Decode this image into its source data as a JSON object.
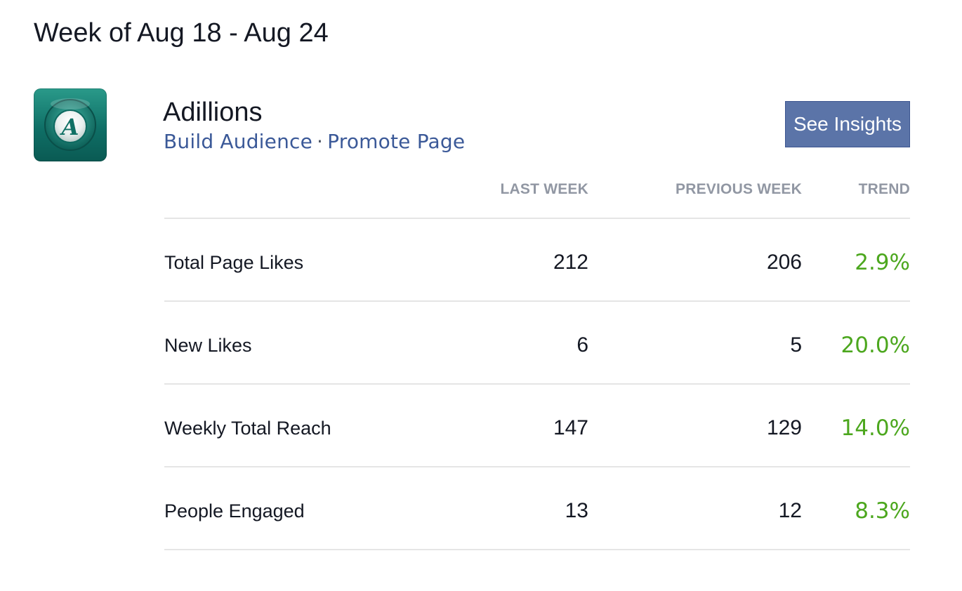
{
  "header": {
    "week_title": "Week of Aug 18 - Aug 24"
  },
  "page": {
    "name": "Adillions",
    "logo_icon": "adillions-logo-icon",
    "logo_letter": "A",
    "links": {
      "build_audience": "Build Audience",
      "separator": "·",
      "promote_page": "Promote Page"
    },
    "see_insights_label": "See Insights"
  },
  "stats": {
    "columns": {
      "last_week": "LAST WEEK",
      "previous_week": "PREVIOUS WEEK",
      "trend": "TREND"
    },
    "rows": [
      {
        "label": "Total Page Likes",
        "last_week": "212",
        "previous_week": "206",
        "trend": "2.9%"
      },
      {
        "label": "New Likes",
        "last_week": "6",
        "previous_week": "5",
        "trend": "20.0%"
      },
      {
        "label": "Weekly Total Reach",
        "last_week": "147",
        "previous_week": "129",
        "trend": "14.0%"
      },
      {
        "label": "People Engaged",
        "last_week": "13",
        "previous_week": "12",
        "trend": "8.3%"
      }
    ]
  },
  "colors": {
    "link": "#3b5998",
    "button_bg": "#5b74a8",
    "trend_positive": "#4ca71e",
    "header_text": "#9197a3",
    "divider": "#e5e5e5"
  }
}
